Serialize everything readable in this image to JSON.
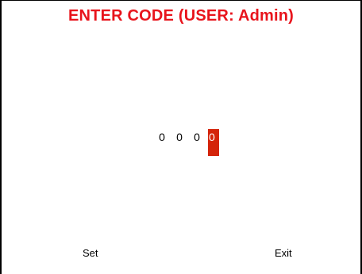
{
  "screen": {
    "title": "ENTER CODE (USER: Admin)",
    "title_color": "#e8141c"
  },
  "code": {
    "digits": [
      "0",
      "0",
      "0",
      "0"
    ],
    "active_index": 3,
    "highlight_color": "#d4240a"
  },
  "softkeys": {
    "left_label": "Set",
    "right_label": "Exit"
  }
}
